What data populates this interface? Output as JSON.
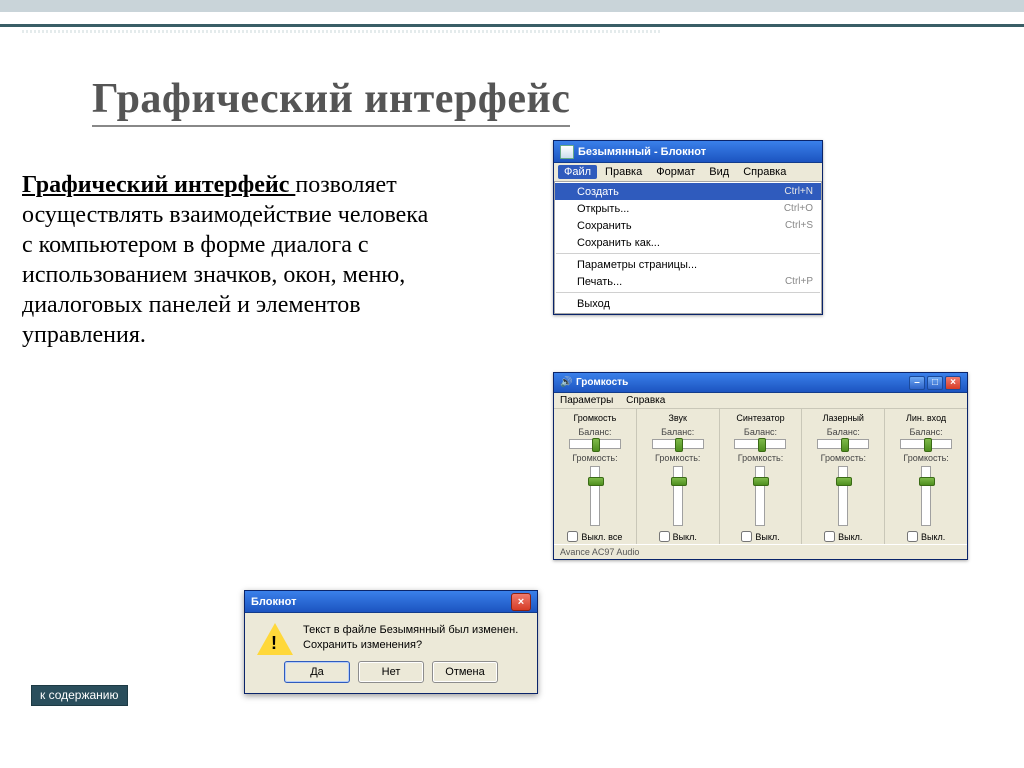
{
  "slide": {
    "title": "Графический интерфейс",
    "bold_lead": "Графический интерфейс ",
    "body_rest": "позволяет осуществлять взаимодействие человека с компьютером в форме диалога с использованием значков, окон, меню, диалоговых панелей и элементов управления."
  },
  "nav": {
    "to_contents": "к содержанию"
  },
  "notepad": {
    "title": "Безымянный - Блокнот",
    "menu": {
      "file": "Файл",
      "edit": "Правка",
      "format": "Формат",
      "view": "Вид",
      "help": "Справка"
    },
    "items": {
      "create": "Создать",
      "create_sc": "Ctrl+N",
      "open": "Открыть...",
      "open_sc": "Ctrl+O",
      "save": "Сохранить",
      "save_sc": "Ctrl+S",
      "saveas": "Сохранить как...",
      "pagesetup": "Параметры страницы...",
      "print": "Печать...",
      "print_sc": "Ctrl+P",
      "exit": "Выход"
    }
  },
  "mixer": {
    "title": "Громкость",
    "menu": {
      "params": "Параметры",
      "help": "Справка"
    },
    "labels": {
      "balance": "Баланс:",
      "volume": "Громкость:",
      "mute_all": "Выкл. все",
      "mute": "Выкл."
    },
    "channels": [
      "Громкость",
      "Звук",
      "Синтезатор",
      "Лазерный",
      "Лин. вход"
    ],
    "status": "Avance AC97 Audio"
  },
  "dialog": {
    "title": "Блокнот",
    "line1": "Текст в файле Безымянный был изменен.",
    "line2": "Сохранить изменения?",
    "yes": "Да",
    "no": "Нет",
    "cancel": "Отмена"
  }
}
